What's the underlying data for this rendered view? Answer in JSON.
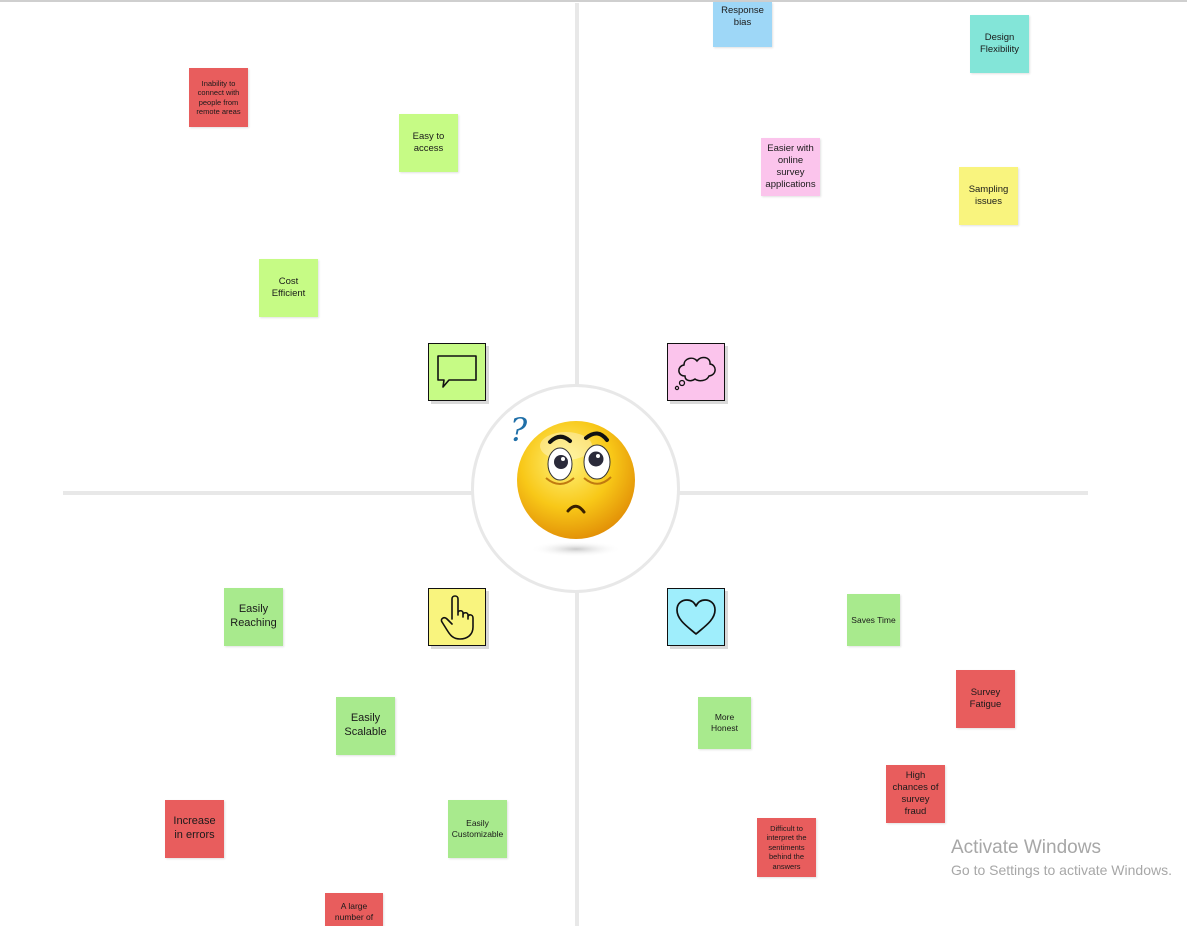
{
  "board": {
    "notes": {
      "remote_areas": "Inability to connect with people from remote areas",
      "easy_access": "Easy to access",
      "cost_efficient": "Cost Efficient",
      "response_bias": "Response bias",
      "design_flexibility": "Design Flexibility",
      "online_survey": "Easier with online survey applications",
      "sampling_issues": "Sampling issues",
      "easily_reaching": "Easily Reaching",
      "easily_scalable": "Easily Scalable",
      "increase_errors": "Increase in errors",
      "easily_customizable": "Easily Customizable",
      "large_number": "A large number of",
      "saves_time": "Saves Time",
      "more_honest": "More Honest",
      "survey_fatigue": "Survey Fatigue",
      "survey_fraud": "High chances of survey fraud",
      "difficult_interpret": "Difficult to interpret the sentiments behind the answers"
    },
    "quadrant_icons": [
      "speech-bubble-icon",
      "thought-cloud-icon",
      "pointing-hand-icon",
      "heart-icon"
    ],
    "center_image": "confused-thinking-emoji"
  },
  "colors": {
    "red": "#e85d5d",
    "green": "#a8ea8d",
    "lime": "#c6fb85",
    "yellow": "#f9f47e",
    "blue": "#9ed7f7",
    "teal": "#83e5d8",
    "pink": "#fbc4ec"
  },
  "watermark": {
    "title": "Activate Windows",
    "subtitle": "Go to Settings to activate Windows."
  }
}
